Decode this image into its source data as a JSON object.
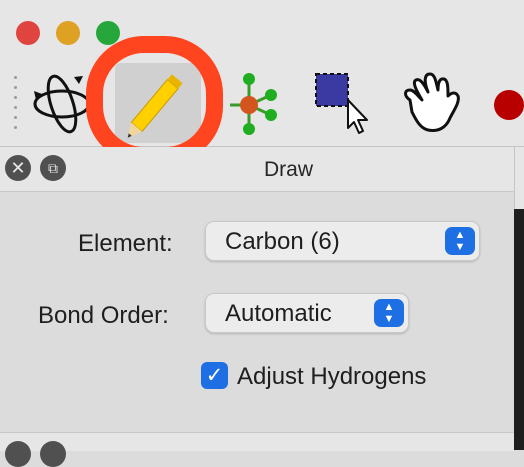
{
  "window": {
    "traffic_lights": {
      "close_color": "#e0443e",
      "minimize_color": "#dea123",
      "zoom_color": "#27a73b"
    }
  },
  "toolbar": {
    "tools": [
      {
        "icon": "navigate-rotate-icon",
        "selected": false
      },
      {
        "icon": "pencil-draw-icon",
        "selected": true
      },
      {
        "icon": "molecule-manipulate-icon",
        "selected": false
      },
      {
        "icon": "selection-rectangle-icon",
        "selected": false
      },
      {
        "icon": "hand-icon",
        "selected": false
      },
      {
        "icon": "red-atom-icon",
        "selected": false
      }
    ],
    "highlight_color": "#ff4520"
  },
  "panel": {
    "title": "Draw",
    "close_icon": "close-icon",
    "float_icon": "float-icon",
    "element_label": "Element:",
    "element_value": "Carbon (6)",
    "bond_order_label": "Bond Order:",
    "bond_order_value": "Automatic",
    "adjust_hydrogens_label": "Adjust Hydrogens",
    "adjust_hydrogens_checked": true
  }
}
